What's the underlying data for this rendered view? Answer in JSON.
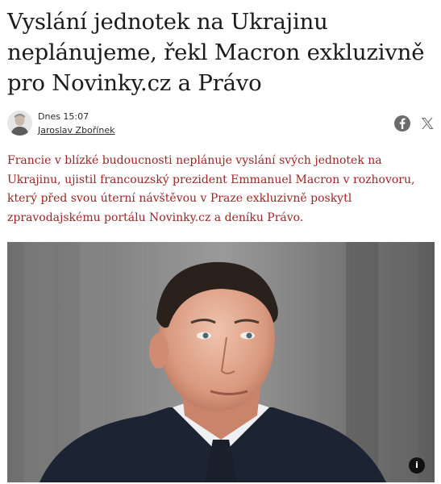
{
  "article": {
    "headline": "Vyslání jednotek na Ukrajinu neplánujeme, řekl Macron exkluzivně pro Novinky.cz a Právo",
    "byline": {
      "date": "Dnes 15:07",
      "author": "Jaroslav Zbořínek"
    },
    "lead": "Francie v blízké budoucnosti neplánuje vyslání svých jednotek na Ukrajinu, ujistil francouzský prezident Emmanuel Macron v rozhovoru, který před svou úterní návštěvou v Praze exkluzivně poskytl zpravodajskému portálu Novinky.cz a deníku Právo.",
    "share_icons": [
      "facebook-icon",
      "x-icon"
    ],
    "photo": {
      "info_label": "i"
    }
  },
  "colors": {
    "lead_text": "#9a2525",
    "headline_text": "#1b1b1b"
  }
}
